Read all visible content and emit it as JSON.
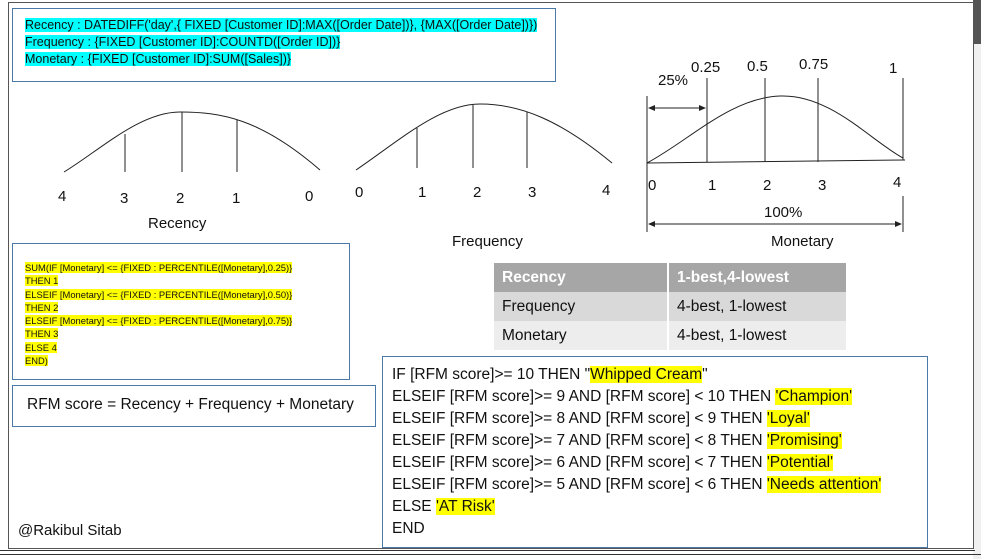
{
  "formulas": {
    "recency": "Recency : DATEDIFF('day',{ FIXED [Customer ID]:MAX([Order Date])}, {MAX([Order Date])})",
    "frequency": "Frequency : {FIXED [Customer ID]:COUNTD([Order ID])}",
    "monetary": "Monetary : {FIXED [Customer ID]:SUM([Sales])}"
  },
  "percentile_calc": [
    "SUM(IF [Monetary] <= {FIXED : PERCENTILE([Monetary],0.25)}",
    "THEN 1",
    "ELSEIF  [Monetary] <= {FIXED : PERCENTILE([Monetary],0.50)}",
    "THEN 2",
    "ELSEIF  [Monetary] <= {FIXED : PERCENTILE([Monetary],0.75)}",
    "THEN 3",
    "ELSE  4",
    "END)"
  ],
  "rfm_score": "RFM score = Recency + Frequency + Monetary",
  "curves": {
    "recency": {
      "title": "Recency",
      "ticks": [
        "4",
        "3",
        "2",
        "1",
        "0"
      ]
    },
    "frequency": {
      "title": "Frequency",
      "ticks": [
        "0",
        "1",
        "2",
        "3",
        "4"
      ]
    },
    "monetary": {
      "title": "Monetary",
      "ticks": [
        "0",
        "1",
        "2",
        "3",
        "4"
      ],
      "quantiles": [
        "0.25",
        "0.5",
        "0.75",
        "1"
      ],
      "pct_25": "25%",
      "pct_100": "100%"
    }
  },
  "score_table": {
    "header": [
      "Recency",
      "1-best,4-lowest"
    ],
    "rows": [
      [
        "Frequency",
        "4-best, 1-lowest"
      ],
      [
        "Monetary",
        "4-best, 1-lowest"
      ]
    ]
  },
  "segment_rules": [
    {
      "prefix": "IF [RFM score]>= 10 THEN \"",
      "segment": "Whipped Cream",
      "suffix": "\""
    },
    {
      "prefix": "ELSEIF [RFM score]>= 9 AND  [RFM score] < 10 THEN ",
      "segment": "'Champion'",
      "suffix": ""
    },
    {
      "prefix": "ELSEIF [RFM score]>= 8 AND  [RFM score] < 9 THEN ",
      "segment": "'Loyal'",
      "suffix": ""
    },
    {
      "prefix": "ELSEIF [RFM score]>= 7 AND  [RFM score] < 8 THEN ",
      "segment": "'Promising'",
      "suffix": ""
    },
    {
      "prefix": "ELSEIF [RFM score]>= 6 AND  [RFM score] < 7 THEN ",
      "segment": "'Potential'",
      "suffix": ""
    },
    {
      "prefix": "ELSEIF [RFM score]>= 5 AND  [RFM score] < 6 THEN ",
      "segment": "'Needs attention'",
      "suffix": ""
    },
    {
      "prefix": "ELSE ",
      "segment": "'AT Risk'",
      "suffix": ""
    },
    {
      "prefix": "END",
      "segment": "",
      "suffix": ""
    }
  ],
  "credit": "@Rakibul Sitab",
  "colors": {
    "formula_highlight": "#00ffff",
    "segment_highlight": "#ffff00",
    "box_border": "#4a79a8"
  }
}
